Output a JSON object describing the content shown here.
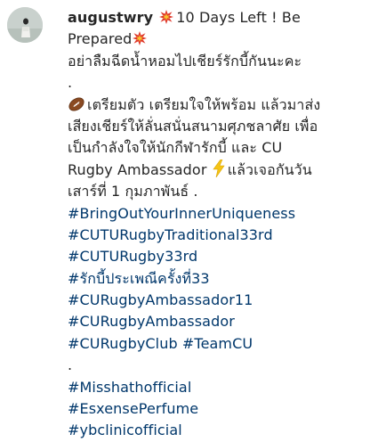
{
  "post": {
    "username": "augustwry",
    "title_line1": "10 Days Left ! Be",
    "title_line2": "Prepared",
    "line3": "อย่าลืมฉีดน้ำหอมไปเชียร์รักบี้กันนะคะ",
    "dot1": ".",
    "body_line1": "เตรียมตัว เตรียมใจให้พร้อม แล้วมาส่ง",
    "body_line2": "เสียงเชียร์ให้ลั่นสนั่นสนามศุภชลาศัย เพื่อ",
    "body_line3": "เป็นกำลังใจให้นักกีฬารักบี้ และ CU",
    "body_line4": "Rugby Ambassador",
    "body_line4_after": "แล้วเจอกันวัน",
    "body_line5": "เสาร์ที่ 1 กุมภาพันธ์ .",
    "hashtags_a": [
      "#BringOutYourInnerUniqueness",
      "#CUTURugbyTraditional33rd",
      "#CUTURugby33rd",
      "#รักบี้ประเพณีครั้งที่33",
      "#CURugbyAmbassador11",
      "#CURugbyAmbassador"
    ],
    "hashtag_club": "#CURugbyClub",
    "hashtag_team": "#TeamCU",
    "dot2": ".",
    "hashtags_b": [
      "#Misshathofficial",
      "#EsxensePerfume",
      "#ybclinicofficial"
    ]
  },
  "icons": {
    "collision": "collision-emoji-icon",
    "football": "rugby-ball-emoji-icon",
    "zap": "lightning-emoji-icon"
  },
  "colors": {
    "text": "#262626",
    "hashtag": "#00376b",
    "collision": "#e0382b",
    "zap": "#f5c416"
  }
}
